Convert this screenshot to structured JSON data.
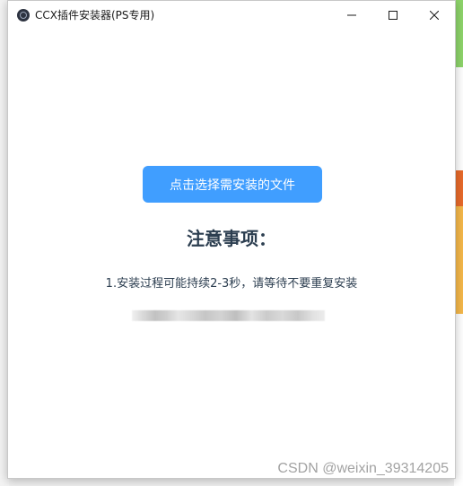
{
  "window": {
    "title": "CCX插件安装器(PS专用)",
    "controls": {
      "minimize": "minimize-icon",
      "maximize": "maximize-icon",
      "close": "close-icon"
    }
  },
  "main": {
    "select_button_label": "点击选择需安装的文件",
    "notice_title": "注意事项：",
    "notice_items": [
      "1.安装过程可能持续2-3秒，请等待不要重复安装"
    ]
  },
  "watermark": "CSDN @weixin_39314205",
  "colors": {
    "primary": "#409eff",
    "text": "#2c3e50",
    "window_bg": "#ffffff"
  }
}
